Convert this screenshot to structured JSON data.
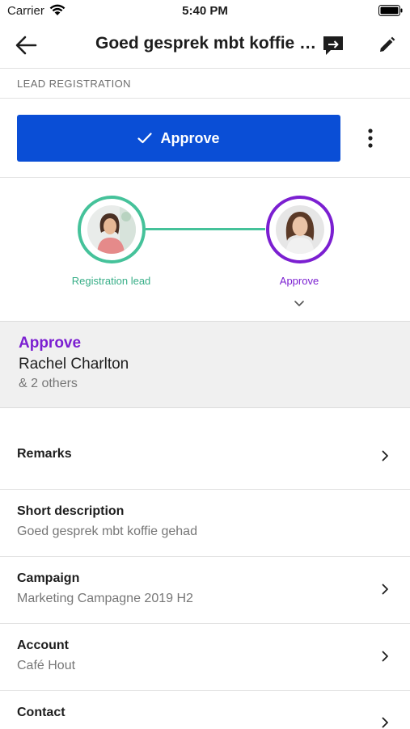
{
  "status_bar": {
    "carrier": "Carrier",
    "time": "5:40 PM"
  },
  "nav": {
    "title": "Goed gesprek mbt koffie gehad"
  },
  "section": {
    "title": "LEAD REGISTRATION"
  },
  "action": {
    "approve_label": "Approve"
  },
  "flow": {
    "steps": [
      {
        "label": "Registration lead",
        "color": "#45c29a"
      },
      {
        "label": "Approve",
        "color": "#7b1fd1"
      }
    ]
  },
  "assignee": {
    "status": "Approve",
    "name": "Rachel Charlton",
    "others": "& 2 others"
  },
  "fields": {
    "remarks": {
      "label": "Remarks"
    },
    "short_description": {
      "label": "Short description",
      "value": "Goed gesprek mbt koffie gehad"
    },
    "campaign": {
      "label": "Campaign",
      "value": "Marketing Campagne 2019 H2"
    },
    "account": {
      "label": "Account",
      "value": "Café Hout"
    },
    "contact": {
      "label": "Contact"
    }
  },
  "colors": {
    "primary": "#0a4ed6",
    "completed": "#45c29a",
    "current": "#7b1fd1"
  }
}
